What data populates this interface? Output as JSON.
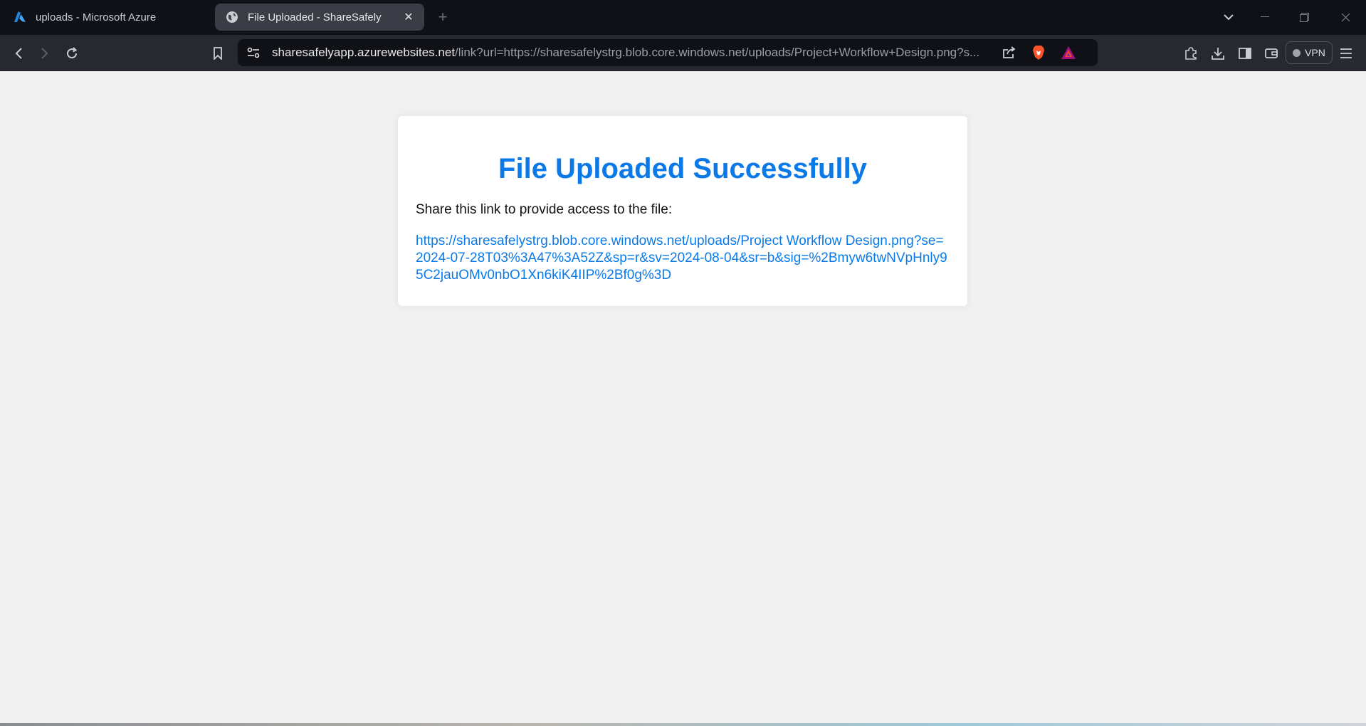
{
  "browser": {
    "tabs": [
      {
        "title": "uploads - Microsoft Azure",
        "icon": "azure-logo-icon",
        "active": false
      },
      {
        "title": "File Uploaded - ShareSafely",
        "icon": "globe-icon",
        "active": true
      }
    ],
    "url": {
      "host": "sharesafelyapp.azurewebsites.net",
      "path": "/link?url=https://sharesafelystrg.blob.core.windows.net/uploads/Project+Workflow+Design.png?s..."
    },
    "vpn_label": "VPN"
  },
  "page": {
    "heading": "File Uploaded Successfully",
    "description": "Share this link to provide access to the file:",
    "share_link": "https://sharesafelystrg.blob.core.windows.net/uploads/Project Workflow Design.png?se=2024-07-28T03%3A47%3A52Z&sp=r&sv=2024-08-04&sr=b&sig=%2Bmyw6twNVpHnly95C2jauOMv0nbO1Xn6kiK4IIP%2Bf0g%3D"
  },
  "colors": {
    "accent": "#0b7ae8",
    "tabstrip_bg": "#0f1117",
    "toolbar_bg": "#262930",
    "page_bg": "#f0f0f0"
  }
}
